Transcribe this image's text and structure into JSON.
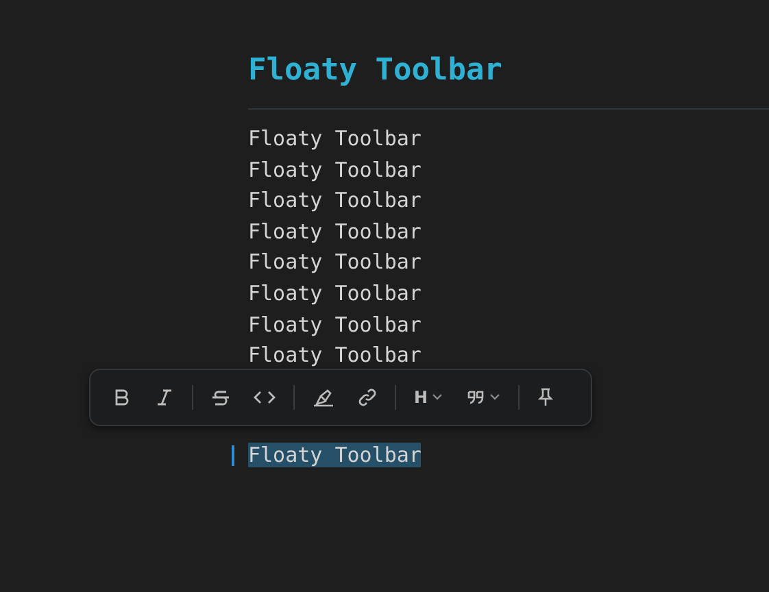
{
  "heading": "Floaty Toolbar",
  "lines": [
    {
      "text": "Floaty Toolbar",
      "selected": false
    },
    {
      "text": "Floaty Toolbar",
      "selected": false
    },
    {
      "text": "Floaty Toolbar",
      "selected": false
    },
    {
      "text": "Floaty Toolbar",
      "selected": false
    },
    {
      "text": "Floaty Toolbar",
      "selected": false
    },
    {
      "text": "Floaty Toolbar",
      "selected": false
    },
    {
      "text": "Floaty Toolbar",
      "selected": false
    },
    {
      "text": "Floaty Toolbar",
      "selected": false
    }
  ],
  "selected_line": {
    "text": "Floaty Toolbar",
    "selected": true
  },
  "toolbar": [
    {
      "kind": "bold"
    },
    {
      "kind": "italic"
    },
    {
      "kind": "separator"
    },
    {
      "kind": "strike"
    },
    {
      "kind": "code"
    },
    {
      "kind": "separator"
    },
    {
      "kind": "highlight"
    },
    {
      "kind": "link"
    },
    {
      "kind": "separator"
    },
    {
      "kind": "heading",
      "label": "H"
    },
    {
      "kind": "quote"
    },
    {
      "kind": "separator"
    },
    {
      "kind": "pin"
    }
  ]
}
